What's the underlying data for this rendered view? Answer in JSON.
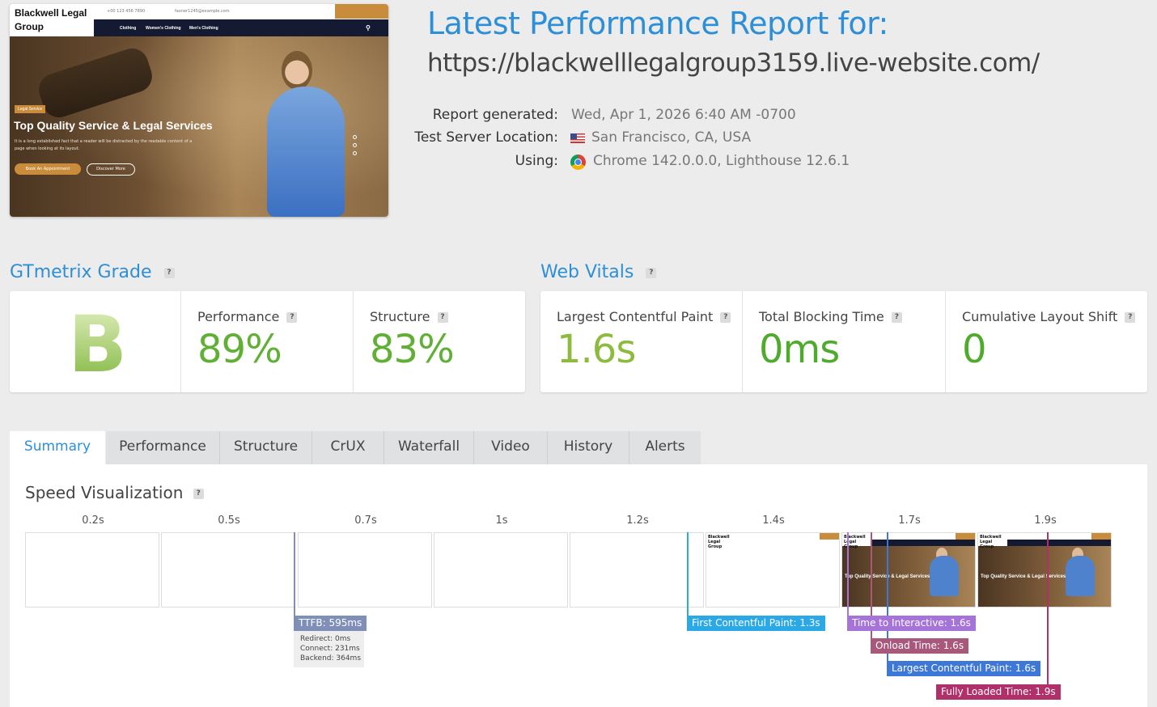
{
  "site_thumbnail": {
    "logo": "Blackwell Legal Group",
    "phone": "+00 123 456 7890",
    "email": "faxner1245@example.com",
    "menu": [
      "Clothing",
      "Women's Clothing",
      "Men's Clothing"
    ],
    "hero_tag": "Legal Service",
    "hero_title": "Top Quality Service & Legal Services",
    "hero_desc": "It is a long established fact that a reader will be distracted by the readable content of a page when looking at its layout.",
    "btn_primary": "Book An Appointment",
    "btn_secondary": "Discover More"
  },
  "header": {
    "title": "Latest Performance Report for:",
    "url": "https://blackwelllegalgroup3159.live-website.com/"
  },
  "meta": {
    "generated_label": "Report generated:",
    "generated_value": "Wed, Apr 1, 2026 6:40 AM -0700",
    "location_label": "Test Server Location:",
    "location_value": "San Francisco, CA, USA",
    "using_label": "Using:",
    "using_value": "Chrome 142.0.0.0, Lighthouse 12.6.1"
  },
  "grade": {
    "heading": "GTmetrix Grade",
    "help": "?",
    "letter": "B",
    "performance_label": "Performance",
    "performance_value": "89%",
    "structure_label": "Structure",
    "structure_value": "83%"
  },
  "vitals": {
    "heading": "Web Vitals",
    "help": "?",
    "lcp_label": "Largest Contentful Paint",
    "lcp_value": "1.6s",
    "tbt_label": "Total Blocking Time",
    "tbt_value": "0ms",
    "cls_label": "Cumulative Layout Shift",
    "cls_value": "0"
  },
  "tabs": [
    "Summary",
    "Performance",
    "Structure",
    "CrUX",
    "Waterfall",
    "Video",
    "History",
    "Alerts"
  ],
  "speed": {
    "heading": "Speed Visualization",
    "ticks": [
      "0.2s",
      "0.5s",
      "0.7s",
      "1s",
      "1.2s",
      "1.4s",
      "1.7s",
      "1.9s"
    ],
    "ttfb": "TTFB: 595ms",
    "redirect": "Redirect: 0ms",
    "connect": "Connect: 231ms",
    "backend": "Backend: 364ms",
    "fcp": "First Contentful Paint: 1.3s",
    "tti": "Time to Interactive: 1.6s",
    "onload": "Onload Time: 1.6s",
    "lcp": "Largest Contentful Paint: 1.6s",
    "fully_loaded": "Fully Loaded Time: 1.9s",
    "frame_logo": "Blackwell Legal Group",
    "frame_title": "Top Quality Service & Legal Services"
  },
  "colors": {
    "accent": "#2d8fd8",
    "good_green": "#5fb035",
    "ttfb": "#7f8fb8",
    "fcp": "#2aa9e6",
    "tti": "#a673d8",
    "onload": "#a8587a",
    "lcp": "#3d78d8",
    "fully_loaded": "#b0306a"
  }
}
